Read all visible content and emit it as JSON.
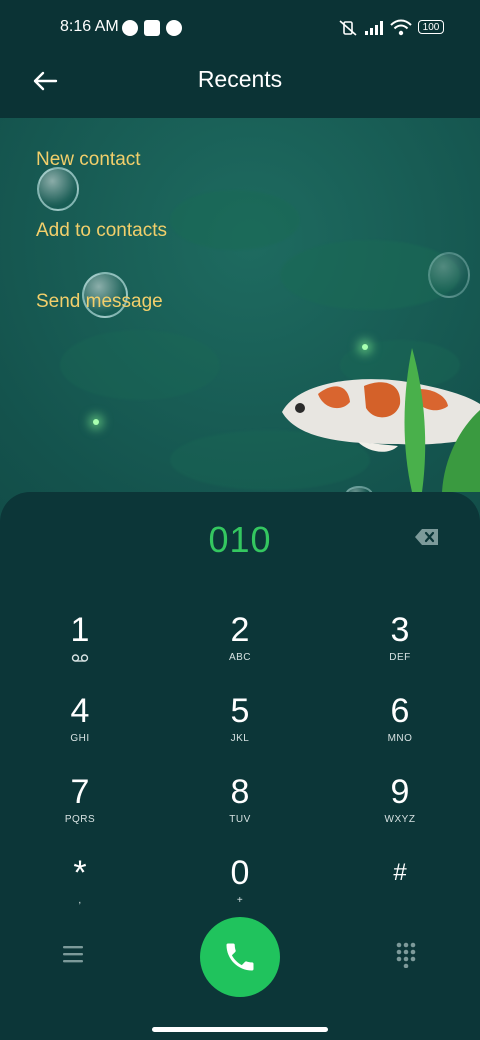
{
  "status_bar": {
    "time": "8:16 AM",
    "battery": "100"
  },
  "header": {
    "title": "Recents",
    "back_icon": "arrow-left-icon"
  },
  "menu": {
    "items": [
      {
        "label": "New contact"
      },
      {
        "label": "Add to contacts"
      },
      {
        "label": "Send message"
      }
    ]
  },
  "dialer": {
    "number": "010",
    "keys": [
      {
        "digit": "1",
        "letters": ""
      },
      {
        "digit": "2",
        "letters": "ABC"
      },
      {
        "digit": "3",
        "letters": "DEF"
      },
      {
        "digit": "4",
        "letters": "GHI"
      },
      {
        "digit": "5",
        "letters": "JKL"
      },
      {
        "digit": "6",
        "letters": "MNO"
      },
      {
        "digit": "7",
        "letters": "PQRS"
      },
      {
        "digit": "8",
        "letters": "TUV"
      },
      {
        "digit": "9",
        "letters": "WXYZ"
      },
      {
        "digit": "*",
        "letters": ","
      },
      {
        "digit": "0",
        "letters": "+"
      },
      {
        "digit": "#",
        "letters": ""
      }
    ]
  },
  "colors": {
    "accent_green": "#34c760",
    "call_button": "#20c35d",
    "menu_text": "#f2cf6b",
    "panel": "#0c3638"
  }
}
